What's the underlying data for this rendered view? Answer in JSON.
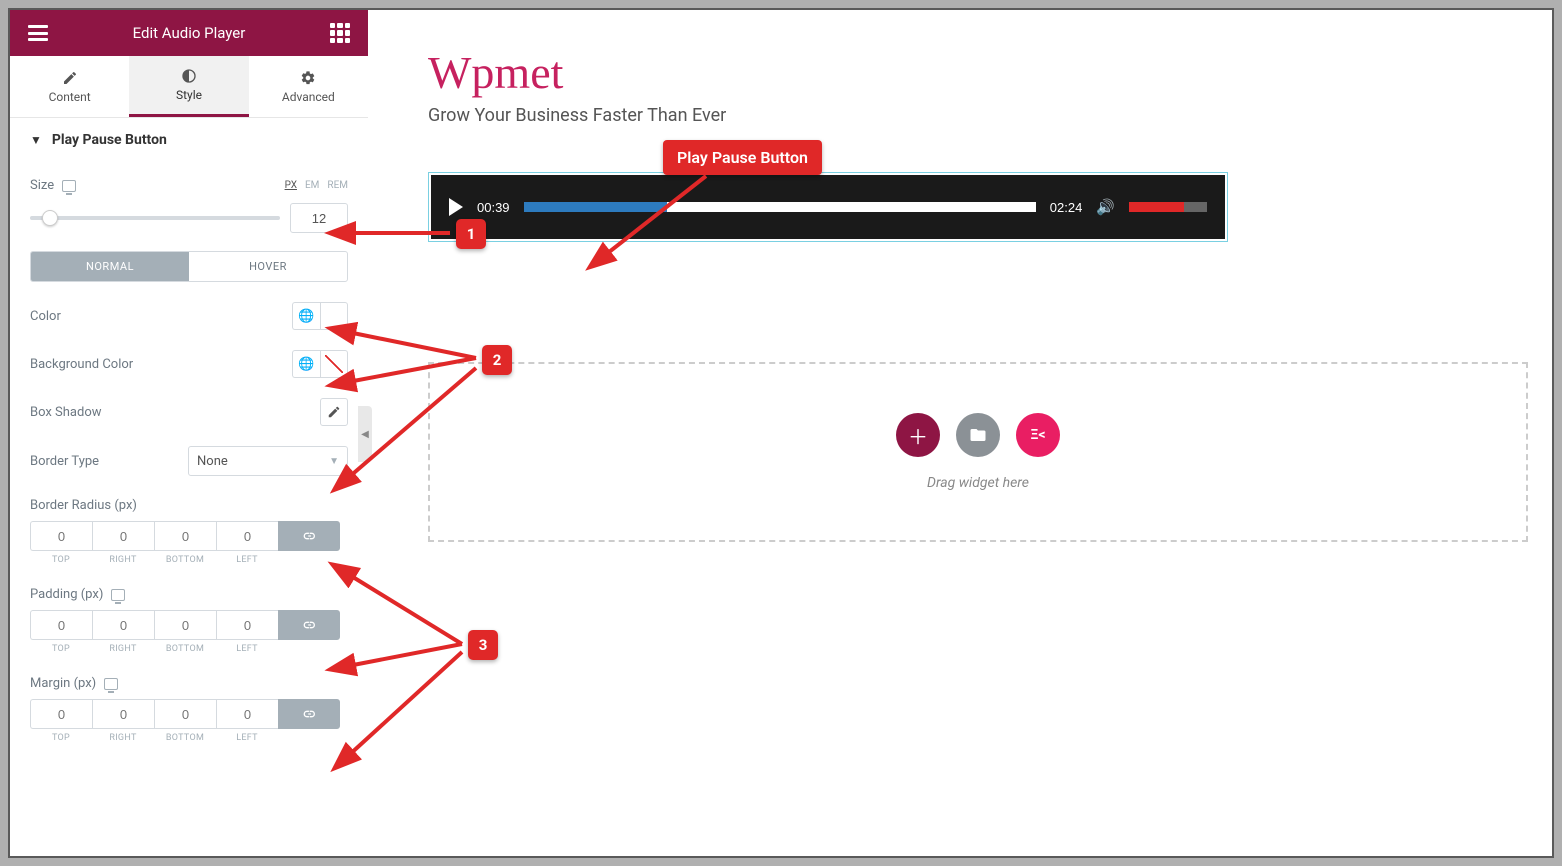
{
  "header": {
    "title": "Edit Audio Player"
  },
  "tabs": {
    "content": "Content",
    "style": "Style",
    "advanced": "Advanced"
  },
  "section": {
    "title": "Play Pause Button"
  },
  "size": {
    "label": "Size",
    "units": {
      "px": "PX",
      "em": "EM",
      "rem": "REM"
    },
    "value": "12"
  },
  "states": {
    "normal": "NORMAL",
    "hover": "HOVER"
  },
  "controls": {
    "color": "Color",
    "bgcolor": "Background Color",
    "boxshadow": "Box Shadow",
    "bordertype": "Border Type",
    "bordertype_value": "None"
  },
  "dims": {
    "radius_label": "Border Radius (px)",
    "padding_label": "Padding (px)",
    "margin_label": "Margin (px)",
    "placeholder": "0",
    "top": "TOP",
    "right": "RIGHT",
    "bottom": "BOTTOM",
    "left": "LEFT"
  },
  "brand": {
    "title": "Wpmet",
    "sub": "Grow Your Business Faster Than Ever"
  },
  "player": {
    "current": "00:39",
    "total": "02:24"
  },
  "dropzone": {
    "text": "Drag widget here"
  },
  "annotations": {
    "callout": "Play Pause Button",
    "n1": "1",
    "n2": "2",
    "n3": "3"
  }
}
